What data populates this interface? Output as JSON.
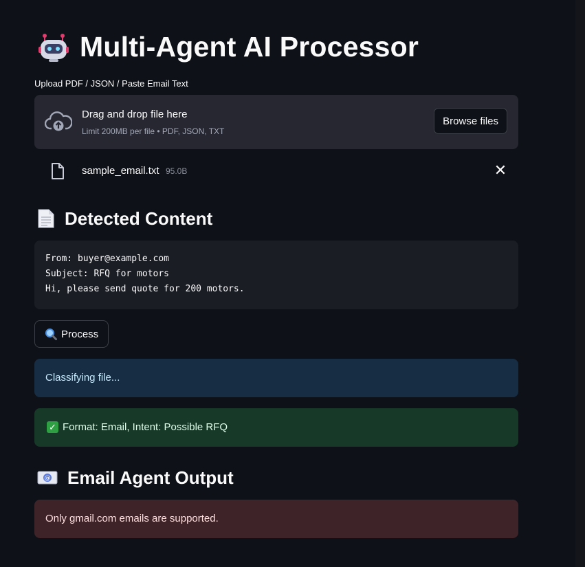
{
  "app": {
    "title": "Multi-Agent AI Processor",
    "title_icon": "robot-icon"
  },
  "uploader": {
    "label": "Upload PDF / JSON / Paste Email Text",
    "drop_title": "Drag and drop file here",
    "drop_subtitle": "Limit 200MB per file • PDF, JSON, TXT",
    "browse_label": "Browse files",
    "cloud_icon": "cloud-upload-icon"
  },
  "uploaded_file": {
    "name": "sample_email.txt",
    "size": "95.0B",
    "file_icon": "file-icon",
    "remove_icon": "close-icon"
  },
  "detected": {
    "heading": "Detected Content",
    "heading_icon": "document-icon",
    "lines": [
      "From: buyer@example.com",
      "Subject: RFQ for motors",
      "Hi, please send quote for 200 motors."
    ]
  },
  "process_button": {
    "label": "Process",
    "icon": "magnifier-icon"
  },
  "messages": {
    "info": "Classifying file...",
    "success": "Format: Email, Intent: Possible RFQ",
    "success_icon": "check-icon"
  },
  "email_agent": {
    "heading": "Email Agent Output",
    "heading_icon": "email-icon",
    "error": "Only gmail.com emails are supported."
  },
  "colors": {
    "background": "#0e1117",
    "info_bg": "#172d43",
    "success_bg": "#173928",
    "error_bg": "#3e2428"
  }
}
